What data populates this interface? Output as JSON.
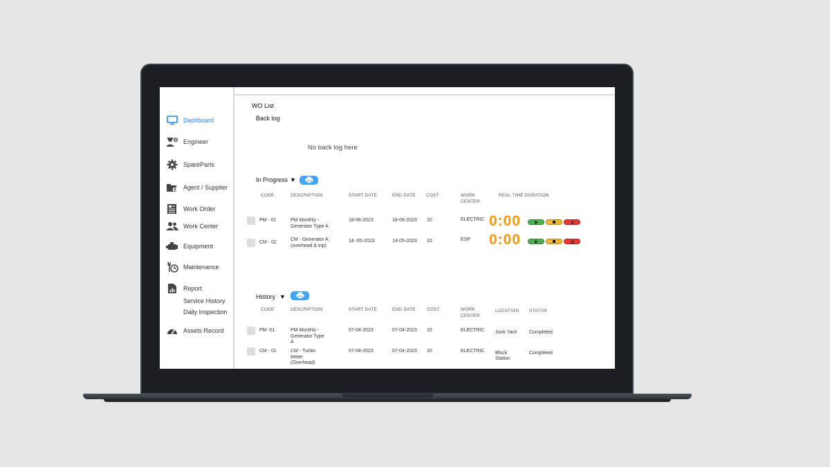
{
  "sidebar": {
    "items": [
      {
        "label": "Dashboard",
        "icon": "monitor-icon"
      },
      {
        "label": "Engineer",
        "icon": "engineer-icon"
      },
      {
        "label": "SpareParts",
        "icon": "gear-icon"
      },
      {
        "label": "Agent / Supplier",
        "icon": "folder-user-icon"
      },
      {
        "label": "Work Order",
        "icon": "document-icon"
      },
      {
        "label": "Work Center",
        "icon": "people-icon"
      },
      {
        "label": "Equipment",
        "icon": "engine-icon"
      },
      {
        "label": "Maintenance",
        "icon": "wrench-clock-icon"
      },
      {
        "label": "Report",
        "icon": "report-icon"
      },
      {
        "label": "Assets Record",
        "icon": "gauge-icon"
      }
    ],
    "report_subitems": [
      "Service History",
      "Daily Inspection"
    ]
  },
  "main": {
    "title": "WO List",
    "backlog": {
      "title": "Back log",
      "empty_text": "No back log here"
    },
    "in_progress": {
      "title": "In Progress",
      "toggle": "▼",
      "headers": {
        "code": "CODE",
        "description": "DESCRIPTION",
        "start": "START DATE",
        "end": "END DATE",
        "cost": "COST",
        "work_center_1": "WORK",
        "work_center_2": "CENTER",
        "duration": "REAL TIME DURATION"
      },
      "rows": [
        {
          "code": "PM - 01",
          "desc1": "PM Monthly -",
          "desc2": "Generator Type A",
          "start": "18-06-2023",
          "end": "18-06-2023",
          "cost": "10",
          "center": "ELECTRIC",
          "timer": "0:00"
        },
        {
          "code": "CM - 02",
          "desc1": "CM - Generator A",
          "desc2": "(overhead & trip)",
          "start": "14 -05-2023",
          "end": "14-05-2023",
          "cost": "10",
          "center": "ESP",
          "timer": "0:00"
        }
      ]
    },
    "history": {
      "title": "History",
      "toggle": "▼",
      "headers": {
        "code": "CODE",
        "description": "DESCRIPTION",
        "start": "START DATE",
        "end": "END DATE",
        "cost": "COST",
        "work_center_1": "WORK",
        "work_center_2": "CENTER",
        "location": "LOCATION",
        "status": "STATUS"
      },
      "rows": [
        {
          "code": "PM -01",
          "desc1": "PM Monthly -",
          "desc2": "Generator Type",
          "desc3": "A",
          "start": "07-04-2023",
          "end": "07-04-2023",
          "cost": "10",
          "center": "ELECTRIC",
          "loc1": "Junk Yard",
          "loc2": "",
          "status": "Completed"
        },
        {
          "code": "CM - 01",
          "desc1": "CM - Turbin",
          "desc2": "Meter",
          "desc3": "(Overhead)",
          "start": "07-04-2023",
          "end": "07-04-2023",
          "cost": "10",
          "center": "ELECTRIC",
          "loc1": "Block",
          "loc2": "Station",
          "status": "Completed"
        }
      ]
    }
  },
  "colors": {
    "accent": "#1e88e5",
    "print_button": "#42a5f5",
    "timer": "#f29a0b",
    "play": "#4caf50",
    "stop": "#f2b632",
    "cancel": "#e53935"
  }
}
